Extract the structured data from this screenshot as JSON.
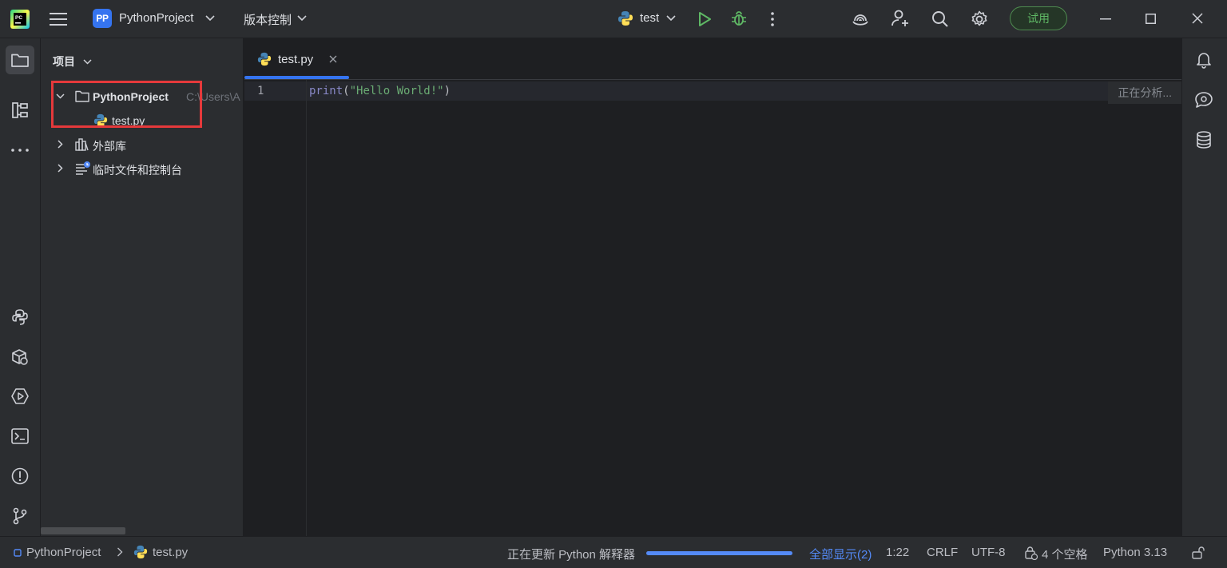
{
  "titlebar": {
    "project_badge": "PP",
    "project_name": "PythonProject",
    "vcs_label": "版本控制",
    "run_config": "test",
    "trial_label": "试用"
  },
  "project_panel": {
    "title": "项目",
    "tree": {
      "root_label": "PythonProject",
      "root_path_hint": "C:\\Users\\A",
      "file_label": "test.py",
      "external_libs_label": "外部库",
      "scratches_label": "临时文件和控制台"
    }
  },
  "editor": {
    "tab_label": "test.py",
    "line_number": "1",
    "code": {
      "fn": "print",
      "open": "(",
      "string": "\"Hello World!\"",
      "close": ")"
    },
    "analyzing_label": "正在分析..."
  },
  "statusbar": {
    "breadcrumb_project": "PythonProject",
    "breadcrumb_file": "test.py",
    "task_label": "正在更新 Python 解释器",
    "task_progress_percent": 100,
    "show_all_label": "全部显示(2)",
    "caret_position": "1:22",
    "line_separator": "CRLF",
    "encoding": "UTF-8",
    "indent": "4 个空格",
    "interpreter": "Python 3.13"
  },
  "colors": {
    "accent": "#3574f0",
    "annotation_box": "#e5393b",
    "run_green": "#5fb865"
  },
  "icons": {
    "app_logo": "pycharm-logo-icon",
    "main_menu": "hamburger-menu-icon",
    "run": "run-icon",
    "debug": "debug-icon",
    "more": "more-vertical-icon",
    "ai": "ai-assistant-icon",
    "add_user": "code-with-me-icon",
    "search": "search-icon",
    "settings": "gear-icon",
    "notifications": "bell-icon",
    "database": "database-icon"
  }
}
